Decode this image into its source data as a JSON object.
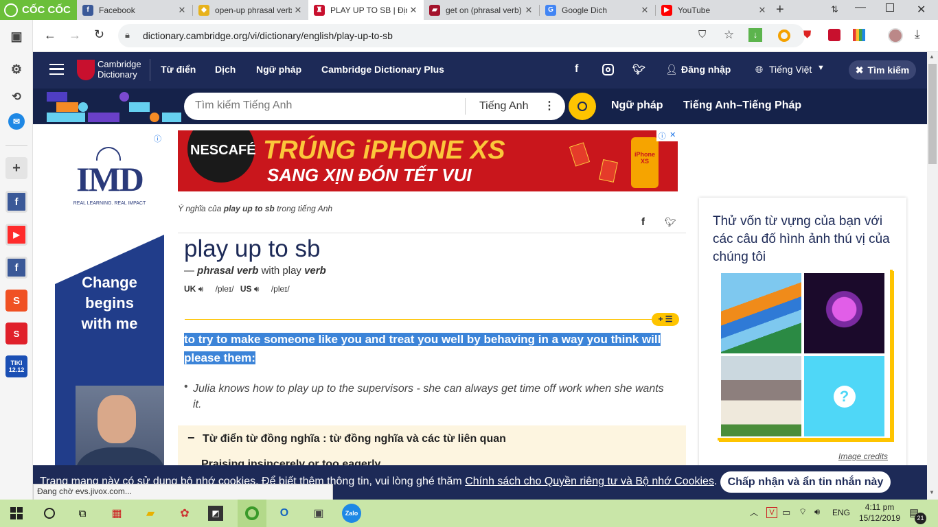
{
  "browser": {
    "brand": "CỐC CỐC",
    "tabs": [
      {
        "title": "Facebook"
      },
      {
        "title": "open-up phrasal verb"
      },
      {
        "title": "PLAY UP TO SB | Định"
      },
      {
        "title": "get on (phrasal verb)"
      },
      {
        "title": "Google Dich"
      },
      {
        "title": "YouTube"
      }
    ],
    "url": "dictionary.cambridge.org/vi/dictionary/english/play-up-to-sb",
    "status": "Đang chờ evs.jivox.com..."
  },
  "site": {
    "logo_line1": "Cambridge",
    "logo_line2": "Dictionary",
    "nav": [
      "Từ điển",
      "Dịch",
      "Ngữ pháp",
      "Cambridge Dictionary Plus"
    ],
    "login": "Đăng nhập",
    "language": "Tiếng Việt",
    "search_button": "Tìm kiếm",
    "search_placeholder": "Tìm kiếm Tiếng Anh",
    "search_lang": "Tiếng Anh",
    "quick_links": [
      "Ngữ pháp",
      "Tiếng Anh–Tiếng Pháp"
    ]
  },
  "ads": {
    "banner_brand": "NESCAFÉ",
    "banner_line1": "TRÚNG iPHONE XS",
    "banner_line2": "SANG XỊN ĐÓN TẾT VUI",
    "banner_phone": "iPhone XS",
    "left_brand": "IMD",
    "left_tagline": "REAL LEARNING. REAL IMPACT",
    "left_slogan_1": "Change",
    "left_slogan_2": "begins",
    "left_slogan_3": "with me"
  },
  "entry": {
    "meaning_prefix": "Ý nghĩa của",
    "meaning_term": "play up to sb",
    "meaning_suffix": "trong tiếng Anh",
    "headword": "play up to sb",
    "pos_dash": "—",
    "pos": "phrasal verb",
    "pos_with": "with play",
    "pos_verb": "verb",
    "uk_label": "UK",
    "uk_ipa": "/pleɪ/",
    "us_label": "US",
    "us_ipa": "/pleɪ/",
    "definition": "to try to make someone like you and treat you well by behaving in a way you think will please them:",
    "example": "Julia knows how to play up to the supervisors - she can always get time off work when she wants it.",
    "thesaurus_title": "Từ điển từ đồng nghĩa : từ đồng nghĩa và các từ liên quan",
    "thesaurus_item": "Praising insincerely or too eagerly"
  },
  "quiz": {
    "title": "Thử vốn từ vựng của bạn với các câu đố hình ảnh thú vị của chúng tôi",
    "question_mark": "?",
    "credits": "Image credits"
  },
  "cookie": {
    "text": "Trang mạng này có sử dụng bộ nhớ cookies. Để biết thêm thông tin, vui lòng ghé thăm",
    "link": "Chính sách cho Quyền riêng tư và Bộ nhớ Cookies",
    "button": "Chấp nhận và ẩn tin nhắn này"
  },
  "taskbar": {
    "lang": "ENG",
    "time": "4:11 pm",
    "date": "15/12/2019",
    "notif_count": "21"
  },
  "colors": {
    "header": "#1d2a57",
    "search_bar": "#15224a",
    "accent_yellow": "#fec400",
    "highlight": "#3c84d8",
    "taskbar": "#c9e6a8"
  }
}
